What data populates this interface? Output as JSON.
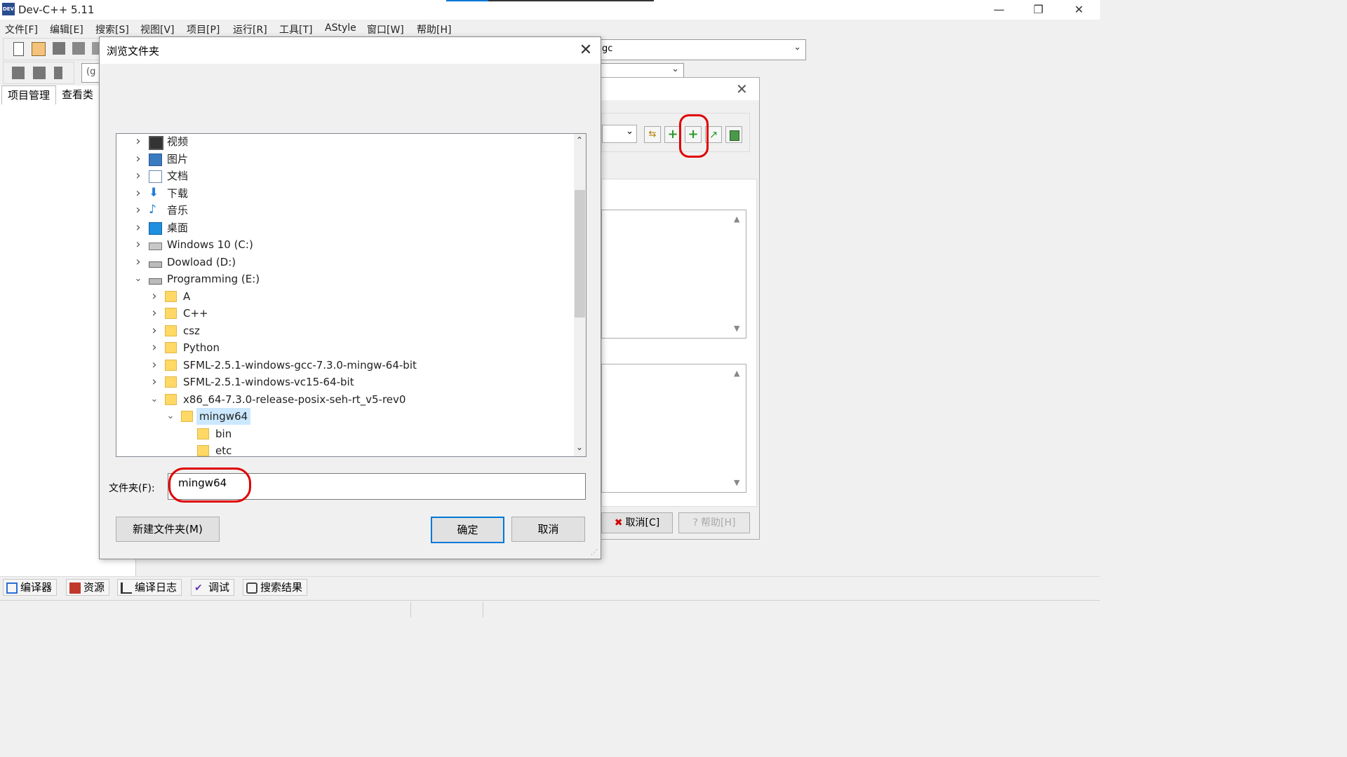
{
  "app": {
    "title": "Dev-C++ 5.11",
    "icon_text": "DEV",
    "minimize": "—",
    "restore": "❐",
    "close": "✕"
  },
  "menu": [
    "文件[F]",
    "编辑[E]",
    "搜索[S]",
    "视图[V]",
    "项目[P]",
    "运行[R]",
    "工具[T]",
    "AStyle",
    "窗口[W]",
    "帮助[H]"
  ],
  "toolbar": {
    "combo_left_text": "(g",
    "compiler_combo_text": "gc"
  },
  "left_panel": {
    "tabs": [
      "项目管理",
      "查看类"
    ]
  },
  "bg_dialog": {
    "close": "✕",
    "cancel_label": "取消[C]",
    "help_label": "帮助[H]"
  },
  "bottom_tabs": [
    {
      "label": "编译器",
      "icon": "grid-icon"
    },
    {
      "label": "资源",
      "icon": "resources-icon"
    },
    {
      "label": "编译日志",
      "icon": "chart-icon"
    },
    {
      "label": "调试",
      "icon": "check-icon"
    },
    {
      "label": "搜索结果",
      "icon": "search-icon"
    }
  ],
  "dialog": {
    "title": "浏览文件夹",
    "close": "✕",
    "tree": [
      {
        "label": "视频",
        "icon": "video-icon",
        "level": 0,
        "expanded": false
      },
      {
        "label": "图片",
        "icon": "pictures-icon",
        "level": 0,
        "expanded": false
      },
      {
        "label": "文档",
        "icon": "documents-icon",
        "level": 0,
        "expanded": false
      },
      {
        "label": "下载",
        "icon": "download-icon",
        "level": 0,
        "expanded": false
      },
      {
        "label": "音乐",
        "icon": "music-icon",
        "level": 0,
        "expanded": false
      },
      {
        "label": "桌面",
        "icon": "desktop-icon",
        "level": 0,
        "expanded": false
      },
      {
        "label": "Windows 10 (C:)",
        "icon": "windows-drive-icon",
        "level": 0,
        "expanded": false
      },
      {
        "label": "Dowload (D:)",
        "icon": "drive-icon",
        "level": 0,
        "expanded": false
      },
      {
        "label": "Programming (E:)",
        "icon": "drive-icon",
        "level": 0,
        "expanded": true
      },
      {
        "label": "A",
        "icon": "folder-icon",
        "level": 1,
        "expanded": false
      },
      {
        "label": "C++",
        "icon": "folder-icon",
        "level": 1,
        "expanded": false
      },
      {
        "label": "csz",
        "icon": "folder-icon",
        "level": 1,
        "expanded": false
      },
      {
        "label": "Python",
        "icon": "folder-icon",
        "level": 1,
        "expanded": false
      },
      {
        "label": "SFML-2.5.1-windows-gcc-7.3.0-mingw-64-bit",
        "icon": "folder-icon",
        "level": 1,
        "expanded": false
      },
      {
        "label": "SFML-2.5.1-windows-vc15-64-bit",
        "icon": "folder-icon",
        "level": 1,
        "expanded": false
      },
      {
        "label": "x86_64-7.3.0-release-posix-seh-rt_v5-rev0",
        "icon": "folder-icon",
        "level": 1,
        "expanded": true
      },
      {
        "label": "mingw64",
        "icon": "folder-icon",
        "level": 2,
        "expanded": true,
        "selected": true
      },
      {
        "label": "bin",
        "icon": "folder-icon",
        "level": 3,
        "leaf": true
      },
      {
        "label": "etc",
        "icon": "folder-icon",
        "level": 3,
        "leaf": true
      }
    ],
    "folder_label": "文件夹(F):",
    "folder_value": "mingw64",
    "new_folder_label": "新建文件夹(M)",
    "ok_label": "确定",
    "cancel_label": "取消"
  },
  "colors": {
    "selection": "#cce8ff",
    "accent": "#0078d7",
    "annotation": "#e00000",
    "folder": "#ffd865"
  }
}
